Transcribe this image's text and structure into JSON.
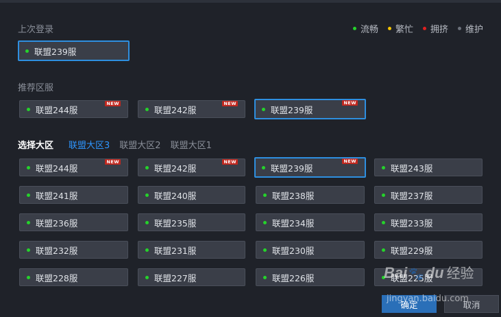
{
  "last_login": {
    "title": "上次登录",
    "server": {
      "label": "联盟239服"
    }
  },
  "legend": [
    {
      "label": "流畅",
      "color": "#25d32b"
    },
    {
      "label": "繁忙",
      "color": "#f5c400"
    },
    {
      "label": "拥挤",
      "color": "#e02020"
    },
    {
      "label": "维护",
      "color": "#6c717b"
    }
  ],
  "recommended": {
    "title": "推荐区服",
    "servers": [
      {
        "label": "联盟244服",
        "badge": "NEW"
      },
      {
        "label": "联盟242服",
        "badge": "NEW"
      },
      {
        "label": "联盟239服",
        "badge": "NEW"
      }
    ]
  },
  "region_select": {
    "label": "选择大区",
    "tabs": [
      "联盟大区3",
      "联盟大区2",
      "联盟大区1"
    ],
    "active_tab": "联盟大区3"
  },
  "servers": [
    {
      "label": "联盟244服",
      "badge": "NEW"
    },
    {
      "label": "联盟242服",
      "badge": "NEW"
    },
    {
      "label": "联盟239服",
      "badge": "NEW"
    },
    {
      "label": "联盟243服"
    },
    {
      "label": "联盟241服"
    },
    {
      "label": "联盟240服"
    },
    {
      "label": "联盟238服"
    },
    {
      "label": "联盟237服"
    },
    {
      "label": "联盟236服"
    },
    {
      "label": "联盟235服"
    },
    {
      "label": "联盟234服"
    },
    {
      "label": "联盟233服"
    },
    {
      "label": "联盟232服"
    },
    {
      "label": "联盟231服"
    },
    {
      "label": "联盟230服"
    },
    {
      "label": "联盟229服"
    },
    {
      "label": "联盟228服"
    },
    {
      "label": "联盟227服"
    },
    {
      "label": "联盟226服"
    },
    {
      "label": "联盟225服"
    }
  ],
  "buttons": {
    "ok": "确定",
    "cancel": "取消"
  },
  "watermark": {
    "logo_left": "Bai",
    "logo_right": "du",
    "brand": "经验",
    "url": "jingyan.baidu.com"
  }
}
